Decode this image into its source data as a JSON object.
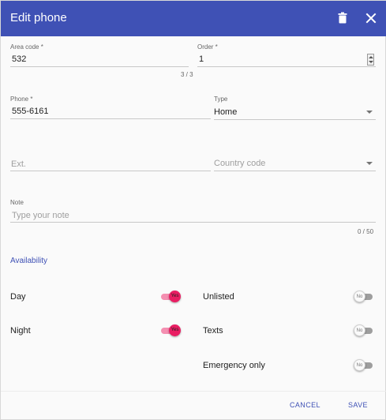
{
  "header": {
    "title": "Edit phone",
    "delete_icon": "trash-icon",
    "close_icon": "close-icon",
    "background": "#3f51b5"
  },
  "fields": {
    "area_code": {
      "label": "Area code *",
      "value": "532",
      "counter": "3 / 3"
    },
    "order": {
      "label": "Order *",
      "value": "1"
    },
    "phone": {
      "label": "Phone *",
      "value": "555-6161"
    },
    "type": {
      "label": "Type",
      "value": "Home"
    },
    "ext": {
      "placeholder": "Ext."
    },
    "country_code": {
      "placeholder": "Country code"
    },
    "note": {
      "label": "Note",
      "placeholder": "Type your note",
      "counter": "0 / 50"
    }
  },
  "availability": {
    "title": "Availability",
    "toggles": [
      {
        "label": "Day",
        "state": "Yes",
        "on": true
      },
      {
        "label": "Night",
        "state": "Yes",
        "on": true
      },
      {
        "label": "Unlisted",
        "state": "No",
        "on": false
      },
      {
        "label": "Texts",
        "state": "No",
        "on": false
      },
      {
        "label": "Emergency only",
        "state": "No",
        "on": false
      }
    ]
  },
  "footer": {
    "cancel_label": "CANCEL",
    "save_label": "SAVE"
  },
  "colors": {
    "accent": "#3f51b5",
    "toggle_on": "#e91e63"
  }
}
